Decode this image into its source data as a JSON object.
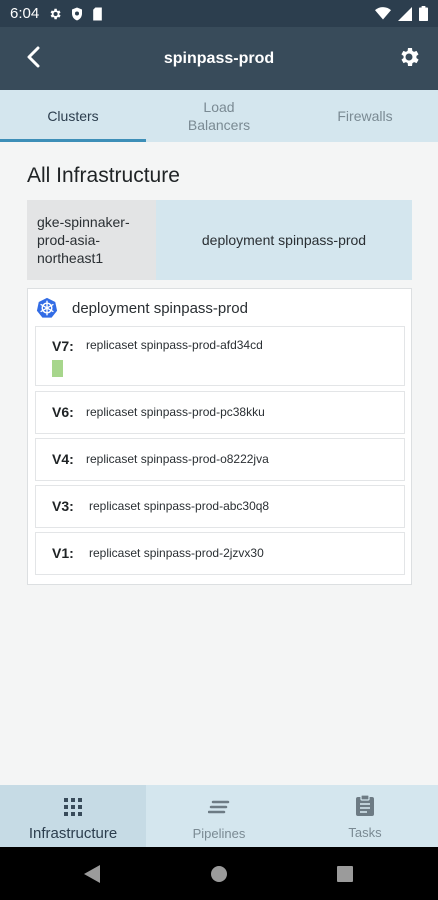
{
  "status_bar": {
    "time": "6:04"
  },
  "app_bar": {
    "title": "spinpass-prod"
  },
  "tabs": [
    {
      "label": "Clusters"
    },
    {
      "label": "Load\nBalancers"
    },
    {
      "label": "Firewalls"
    }
  ],
  "main": {
    "section_title": "All Infrastructure",
    "cluster": {
      "name": "gke-spinnaker-prod-asia-northeast1",
      "deployment_label": "deployment spinpass-prod"
    },
    "deployment": {
      "label": "deployment spinpass-prod",
      "replicasets": [
        {
          "version": "V7:",
          "name": "replicaset spinpass-prod-afd34cd"
        },
        {
          "version": "V6:",
          "name": "replicaset spinpass-prod-pc38kku"
        },
        {
          "version": "V4:",
          "name": "replicaset spinpass-prod-o8222jva"
        },
        {
          "version": "V3:",
          "name": "replicaset spinpass-prod-abc30q8"
        },
        {
          "version": "V1:",
          "name": "replicaset spinpass-prod-2jzvx30"
        }
      ]
    }
  },
  "bottom_nav": [
    {
      "label": "Infrastructure",
      "icon": "grid-icon"
    },
    {
      "label": "Pipelines",
      "icon": "pipelines-icon"
    },
    {
      "label": "Tasks",
      "icon": "clipboard-icon"
    }
  ],
  "colors": {
    "app_bar": "#384b5a",
    "status_bar": "#2c3e4e",
    "tab_bar": "#d4e6ee",
    "tab_indicator": "#3d8fb8",
    "instance_healthy": "#a7d68c",
    "kubernetes_blue": "#326ce5"
  }
}
